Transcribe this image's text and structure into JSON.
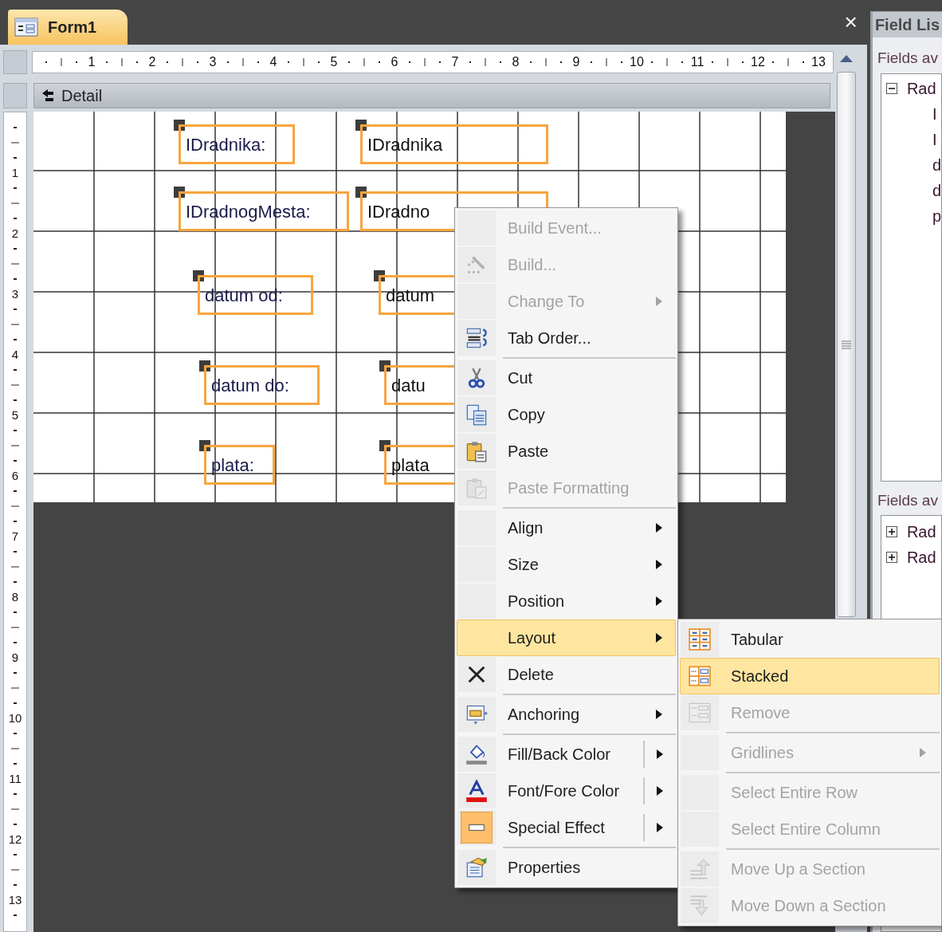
{
  "document_tab": {
    "title": "Form1",
    "selected": true
  },
  "close_label": "×",
  "horizontal_ruler": [
    "1",
    "2",
    "3",
    "4",
    "5",
    "6",
    "7",
    "8",
    "9",
    "10",
    "11",
    "12",
    "13"
  ],
  "vertical_ruler": [
    "1",
    "2",
    "3",
    "4",
    "5",
    "6",
    "7",
    "8",
    "9",
    "10",
    "11",
    "12",
    "13"
  ],
  "section": "Detail",
  "controls": [
    {
      "kind": "label",
      "text": "IDradnika:",
      "selected": true
    },
    {
      "kind": "textbox",
      "text": "IDradnika",
      "selected": true
    },
    {
      "kind": "label",
      "text": "IDradnogMesta:",
      "selected": true
    },
    {
      "kind": "textbox",
      "text": "IDradno",
      "selected": true
    },
    {
      "kind": "label",
      "text": "datum od:",
      "selected": true
    },
    {
      "kind": "textbox",
      "text": "datum",
      "selected": true
    },
    {
      "kind": "label",
      "text": "datum do:",
      "selected": true
    },
    {
      "kind": "textbox",
      "text": "datu",
      "selected": true
    },
    {
      "kind": "label",
      "text": "plata:",
      "selected": true
    },
    {
      "kind": "textbox",
      "text": "plata",
      "selected": true
    }
  ],
  "field_list": {
    "title": "Field Lis",
    "available_label": "Fields av",
    "tables": [
      {
        "name": "Rad",
        "expanded": true,
        "children": [
          "I",
          "I",
          "d",
          "d",
          "p"
        ]
      }
    ],
    "other_label": "Fields av",
    "other_tables": [
      {
        "name": "Rad",
        "expanded": false
      },
      {
        "name": "Rad",
        "expanded": false
      }
    ]
  },
  "context_menu": {
    "items": [
      {
        "kind": "item",
        "label": "Build Event...",
        "disabled": true,
        "submenu": false,
        "split": false,
        "checked": false,
        "selected": false
      },
      {
        "kind": "item",
        "label": "Build...",
        "disabled": true,
        "submenu": false,
        "split": false,
        "checked": false,
        "selected": false
      },
      {
        "kind": "item",
        "label": "Change To",
        "disabled": true,
        "submenu": true,
        "split": false,
        "checked": false,
        "selected": false
      },
      {
        "kind": "item",
        "label": "Tab Order...",
        "disabled": false,
        "submenu": false,
        "split": false,
        "checked": false,
        "selected": false
      },
      {
        "kind": "separator"
      },
      {
        "kind": "item",
        "label": "Cut",
        "disabled": false,
        "submenu": false,
        "split": false,
        "checked": false,
        "selected": false
      },
      {
        "kind": "item",
        "label": "Copy",
        "disabled": false,
        "submenu": false,
        "split": false,
        "checked": false,
        "selected": false
      },
      {
        "kind": "item",
        "label": "Paste",
        "disabled": false,
        "submenu": false,
        "split": false,
        "checked": false,
        "selected": false
      },
      {
        "kind": "item",
        "label": "Paste Formatting",
        "disabled": true,
        "submenu": false,
        "split": false,
        "checked": false,
        "selected": false
      },
      {
        "kind": "separator"
      },
      {
        "kind": "item",
        "label": "Align",
        "disabled": false,
        "submenu": true,
        "split": false,
        "checked": false,
        "selected": false
      },
      {
        "kind": "item",
        "label": "Size",
        "disabled": false,
        "submenu": true,
        "split": false,
        "checked": false,
        "selected": false
      },
      {
        "kind": "item",
        "label": "Position",
        "disabled": false,
        "submenu": true,
        "split": false,
        "checked": false,
        "selected": false
      },
      {
        "kind": "item",
        "label": "Layout",
        "disabled": false,
        "submenu": true,
        "split": false,
        "checked": false,
        "selected": true
      },
      {
        "kind": "item",
        "label": "Delete",
        "disabled": false,
        "submenu": false,
        "split": false,
        "checked": false,
        "selected": false
      },
      {
        "kind": "separator"
      },
      {
        "kind": "item",
        "label": "Anchoring",
        "disabled": false,
        "submenu": true,
        "split": false,
        "checked": false,
        "selected": false
      },
      {
        "kind": "separator"
      },
      {
        "kind": "item",
        "label": "Fill/Back Color",
        "disabled": false,
        "submenu": true,
        "split": true,
        "checked": false,
        "selected": false
      },
      {
        "kind": "item",
        "label": "Font/Fore Color",
        "disabled": false,
        "submenu": true,
        "split": true,
        "checked": false,
        "selected": false
      },
      {
        "kind": "item",
        "label": "Special Effect",
        "disabled": false,
        "submenu": true,
        "split": true,
        "checked": true,
        "selected": false
      },
      {
        "kind": "separator"
      },
      {
        "kind": "item",
        "label": "Properties",
        "disabled": false,
        "submenu": false,
        "split": false,
        "checked": false,
        "selected": false
      }
    ]
  },
  "layout_submenu": {
    "items": [
      {
        "kind": "item",
        "label": "Tabular",
        "disabled": false,
        "submenu": false,
        "selected": false
      },
      {
        "kind": "item",
        "label": "Stacked",
        "disabled": false,
        "submenu": false,
        "selected": true
      },
      {
        "kind": "item",
        "label": "Remove",
        "disabled": true,
        "submenu": false,
        "selected": false
      },
      {
        "kind": "separator"
      },
      {
        "kind": "item",
        "label": "Gridlines",
        "disabled": true,
        "submenu": true,
        "selected": false
      },
      {
        "kind": "separator"
      },
      {
        "kind": "item",
        "label": "Select Entire Row",
        "disabled": true,
        "submenu": false,
        "selected": false
      },
      {
        "kind": "item",
        "label": "Select Entire Column",
        "disabled": true,
        "submenu": false,
        "selected": false
      },
      {
        "kind": "separator"
      },
      {
        "kind": "item",
        "label": "Move Up a Section",
        "disabled": true,
        "submenu": false,
        "selected": false
      },
      {
        "kind": "item",
        "label": "Move Down a Section",
        "disabled": true,
        "submenu": false,
        "selected": false
      }
    ]
  }
}
